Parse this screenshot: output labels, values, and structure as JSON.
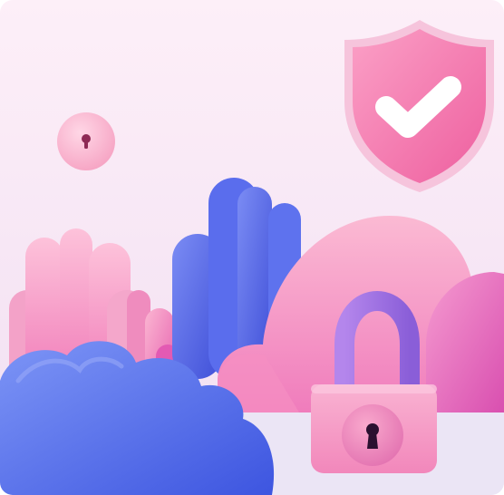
{
  "scene": {
    "kind": "illustration",
    "elements": [
      "shield-check-icon",
      "keyhole-badge-icon",
      "padlock-icon",
      "pink-rock-formation",
      "blue-rock-formation",
      "pink-cloud-hills",
      "blue-cloud"
    ],
    "colors": {
      "background_top": "#fdeef8",
      "background_bottom": "#f3e0f0",
      "floor": "#ece6f6",
      "pink_light": "#fbb0cf",
      "pink_mid": "#f58bbd",
      "magenta": "#e35ab3",
      "blue": "#4f63e6",
      "blue_light": "#6f86f2",
      "shield": "#f47ab0",
      "padlock_body": "#f59ac4",
      "shackle": "#9a6ee0",
      "check": "#ffffff"
    }
  }
}
